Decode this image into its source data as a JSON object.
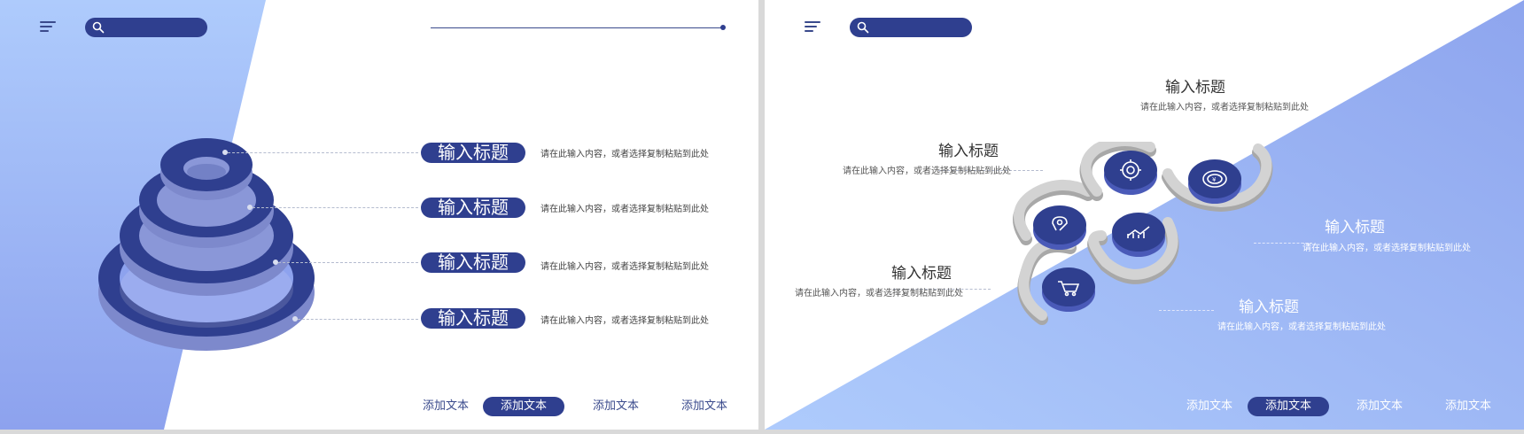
{
  "colors": {
    "brand": "#2f3f8f",
    "accent_light": "#a9c4fb",
    "accent_mid": "#8ea5ee",
    "gray_spiral": "#c8c8c8"
  },
  "left_slide": {
    "header": {
      "menu_icon": "hamburger-menu-icon",
      "search_icon": "search-icon"
    },
    "items": [
      {
        "title": "输入标题",
        "desc": "请在此输入内容，或者选择复制粘贴到此处"
      },
      {
        "title": "输入标题",
        "desc": "请在此输入内容，或者选择复制粘贴到此处"
      },
      {
        "title": "输入标题",
        "desc": "请在此输入内容，或者选择复制粘贴到此处"
      },
      {
        "title": "输入标题",
        "desc": "请在此输入内容，或者选择复制粘贴到此处"
      }
    ],
    "nav": [
      "添加文本",
      "添加文本",
      "添加文本",
      "添加文本"
    ],
    "nav_active_index": 1
  },
  "right_slide": {
    "header": {
      "menu_icon": "hamburger-menu-icon",
      "search_icon": "search-icon"
    },
    "items": [
      {
        "title": "输入标题",
        "desc": "请在此输入内容，或者选择复制粘贴到此处"
      },
      {
        "title": "输入标题",
        "desc": "请在此输入内容，或者选择复制粘贴到此处"
      },
      {
        "title": "输入标题",
        "desc": "请在此输入内容，或者选择复制粘贴到此处"
      },
      {
        "title": "输入标题",
        "desc": "请在此输入内容，或者选择复制粘贴到此处"
      },
      {
        "title": "输入标题",
        "desc": "请在此输入内容，或者选择复制粘贴到此处"
      }
    ],
    "icons": [
      "gear-icon",
      "coin-icon",
      "location-pin-icon",
      "growth-chart-icon",
      "shopping-cart-icon"
    ],
    "nav": [
      "添加文本",
      "添加文本",
      "添加文本",
      "添加文本"
    ],
    "nav_active_index": 1
  }
}
